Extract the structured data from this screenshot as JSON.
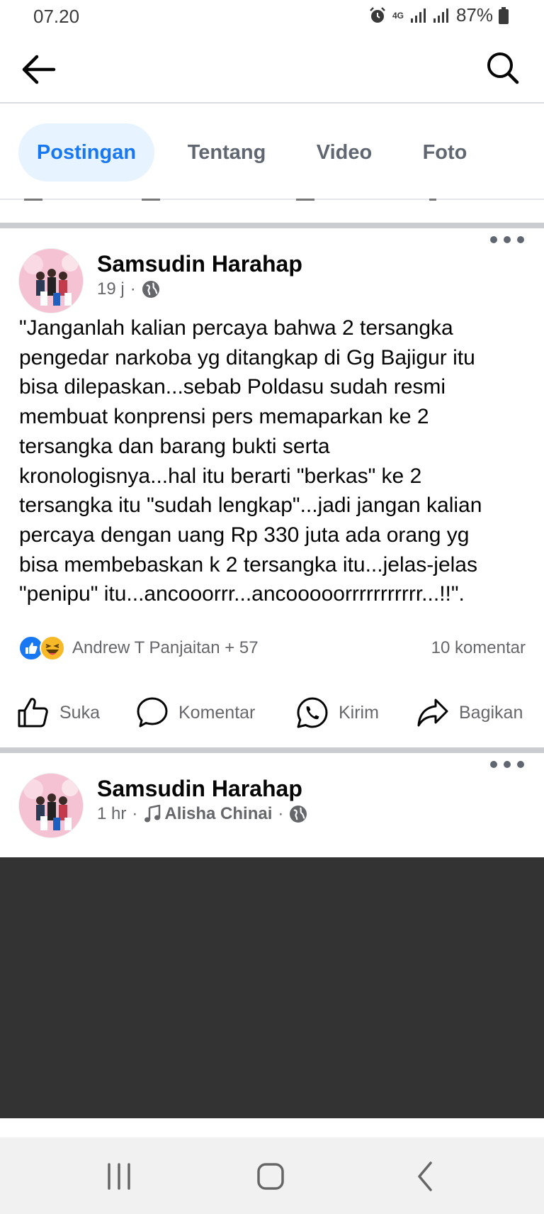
{
  "status": {
    "time": "07.20",
    "network": "4G",
    "battery": "87%"
  },
  "tabs": [
    {
      "label": "Postingan"
    },
    {
      "label": "Tentang"
    },
    {
      "label": "Video"
    },
    {
      "label": "Foto"
    }
  ],
  "posts": [
    {
      "author": "Samsudin Harahap",
      "time": "19 j",
      "text": "\"Janganlah kalian percaya bahwa 2 tersangka\npengedar narkoba yg ditangkap di Gg Bajigur itu\nbisa dilepaskan...sebab Poldasu sudah resmi\nmembuat konprensi pers memaparkan ke 2\ntersangka dan barang bukti serta\nkronologisnya...hal itu berarti \"berkas\" ke 2\ntersangka itu \"sudah lengkap\"...jadi jangan kalian\npercaya dengan uang Rp 330 juta ada orang yg\nbisa membebaskan k 2 tersangka itu...jelas-jelas\n\"penipu\" itu...ancooorrr...ancooooorrrrrrrrrrr...!!\".",
      "reactions_text": "Andrew T Panjaitan + 57",
      "comments": "10 komentar",
      "actions": {
        "like": "Suka",
        "comment": "Komentar",
        "send": "Kirim",
        "share": "Bagikan"
      }
    },
    {
      "author": "Samsudin Harahap",
      "time": "1 hr",
      "music": "Alisha Chinai"
    }
  ]
}
